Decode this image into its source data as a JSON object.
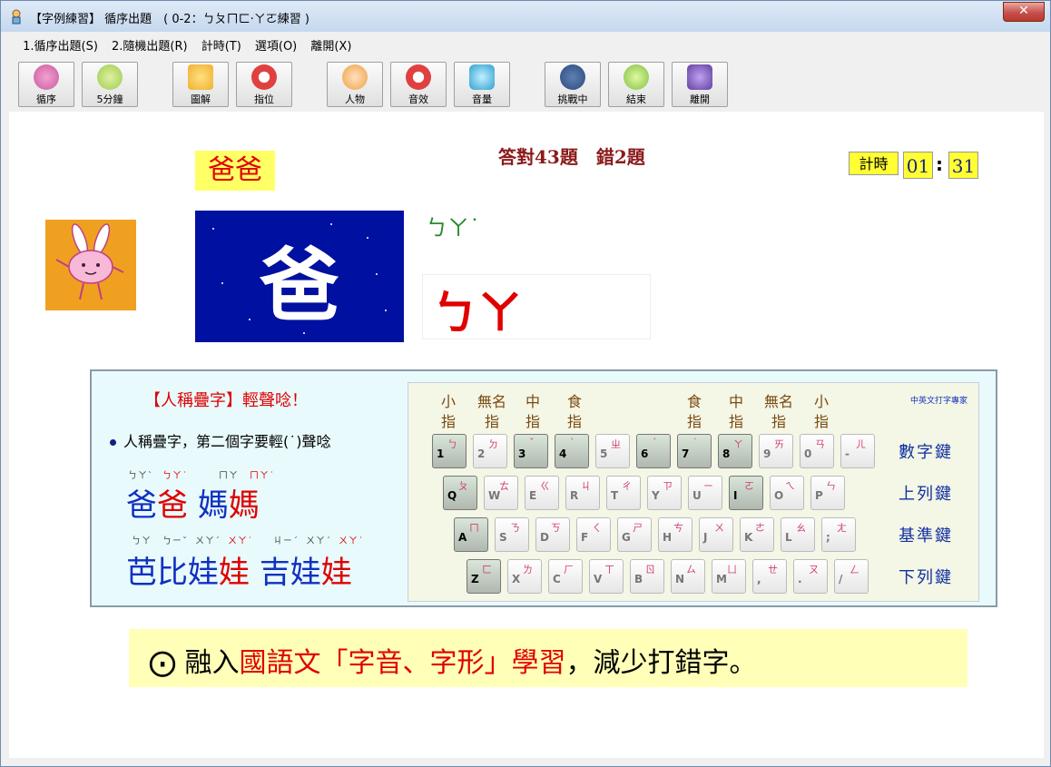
{
  "window": {
    "title": "【字例練習】 循序出題　( 0-2：ㄅㄆㄇㄈ‧ㄚㄛ練習 )",
    "close_label": "✕"
  },
  "menu": [
    {
      "label": "1.循序出題(S)"
    },
    {
      "label": "2.隨機出題(R)"
    },
    {
      "label": "計時(T)"
    },
    {
      "label": "選項(O)"
    },
    {
      "label": "離開(X)"
    }
  ],
  "toolbar": [
    {
      "label": "循序",
      "icon": "home-icon",
      "color": "#c85aa0"
    },
    {
      "label": "5分鐘",
      "icon": "clock-icon",
      "color": "#9ccc50"
    },
    {
      "label": "圖解",
      "icon": "clipboard-icon",
      "color": "#f0b030"
    },
    {
      "label": "指位",
      "icon": "no-finger-icon",
      "color": "#e04040"
    },
    {
      "label": "人物",
      "icon": "character-icon",
      "color": "#f0a040"
    },
    {
      "label": "音效",
      "icon": "no-sound-icon",
      "color": "#e04040"
    },
    {
      "label": "音量",
      "icon": "speaker-icon",
      "color": "#30a0d0"
    },
    {
      "label": "挑戰中",
      "icon": "start-icon",
      "color": "#2a4a80"
    },
    {
      "label": "結束",
      "icon": "off-icon",
      "color": "#80c040"
    },
    {
      "label": "離開",
      "icon": "exit-door-icon",
      "color": "#6040a0"
    }
  ],
  "score": "答對43題　錯2題",
  "timer": {
    "label": "計時",
    "minutes": "01",
    "colon": ":",
    "seconds": "31"
  },
  "word_label": "爸爸",
  "current_char": "爸",
  "zhuyin_hint": "ㄅㄚ˙",
  "typed_input": "ㄅㄚ",
  "tip": {
    "title": "【人稱疊字】輕聲唸！",
    "bullet": "人稱疊字，第二個字要輕(˙)聲唸",
    "row1_zy": [
      "ㄅㄚˋ",
      "ㄅㄚ˙",
      "ㄇㄚ",
      "ㄇㄚ˙"
    ],
    "row1_chars": [
      "爸",
      "爸",
      "媽",
      "媽"
    ],
    "row2_zy": [
      "ㄅㄚ",
      "ㄅㄧˇ",
      "ㄨㄚˊ",
      "ㄨㄚ˙",
      "ㄐㄧˊ",
      "ㄨㄚˊ",
      "ㄨㄚ˙"
    ],
    "row2_chars": [
      "芭",
      "比",
      "娃",
      "娃",
      "吉",
      "娃",
      "娃"
    ]
  },
  "keyboard": {
    "brand": "中英文打字專家",
    "fingers_left": [
      "小\n指",
      "無名\n指",
      "中\n指",
      "食\n指"
    ],
    "fingers_right": [
      "食\n指",
      "中\n指",
      "無名\n指",
      "小\n指"
    ],
    "row_names": [
      "數字鍵",
      "上列鍵",
      "基準鍵",
      "下列鍵"
    ],
    "rows": [
      [
        {
          "l": "1",
          "z": "ㄅ",
          "s": true
        },
        {
          "l": "2",
          "z": "ㄉ"
        },
        {
          "l": "3",
          "z": "ˇ",
          "s": true
        },
        {
          "l": "4",
          "z": "ˋ",
          "s": true
        },
        {
          "l": "5",
          "z": "ㄓ"
        },
        {
          "l": "6",
          "z": "ˊ",
          "s": true
        },
        {
          "l": "7",
          "z": "˙",
          "s": true
        },
        {
          "l": "8",
          "z": "ㄚ",
          "s": true
        },
        {
          "l": "9",
          "z": "ㄞ"
        },
        {
          "l": "0",
          "z": "ㄢ"
        },
        {
          "l": "-",
          "z": "ㄦ"
        }
      ],
      [
        {
          "l": "Q",
          "z": "ㄆ",
          "s": true
        },
        {
          "l": "W",
          "z": "ㄊ"
        },
        {
          "l": "E",
          "z": "ㄍ"
        },
        {
          "l": "R",
          "z": "ㄐ"
        },
        {
          "l": "T",
          "z": "ㄔ"
        },
        {
          "l": "Y",
          "z": "ㄗ"
        },
        {
          "l": "U",
          "z": "ㄧ"
        },
        {
          "l": "I",
          "z": "ㄛ",
          "s": true
        },
        {
          "l": "O",
          "z": "ㄟ"
        },
        {
          "l": "P",
          "z": "ㄣ"
        }
      ],
      [
        {
          "l": "A",
          "z": "ㄇ",
          "s": true
        },
        {
          "l": "S",
          "z": "ㄋ"
        },
        {
          "l": "D",
          "z": "ㄎ"
        },
        {
          "l": "F",
          "z": "ㄑ"
        },
        {
          "l": "G",
          "z": "ㄕ"
        },
        {
          "l": "H",
          "z": "ㄘ"
        },
        {
          "l": "J",
          "z": "ㄨ"
        },
        {
          "l": "K",
          "z": "ㄜ"
        },
        {
          "l": "L",
          "z": "ㄠ"
        },
        {
          "l": ";",
          "z": "ㄤ"
        }
      ],
      [
        {
          "l": "Z",
          "z": "ㄈ",
          "s": true
        },
        {
          "l": "X",
          "z": "ㄌ"
        },
        {
          "l": "C",
          "z": "ㄏ"
        },
        {
          "l": "V",
          "z": "ㄒ"
        },
        {
          "l": "B",
          "z": "ㄖ"
        },
        {
          "l": "N",
          "z": "ㄙ"
        },
        {
          "l": "M",
          "z": "ㄩ"
        },
        {
          "l": ",",
          "z": "ㄝ"
        },
        {
          "l": ".",
          "z": "ㄡ"
        },
        {
          "l": "/",
          "z": "ㄥ"
        }
      ]
    ]
  },
  "slogan": {
    "prefix": "⨀ 融入",
    "highlight1": "國語文「字音、字形」學習",
    "suffix": "，減少打錯字。"
  }
}
